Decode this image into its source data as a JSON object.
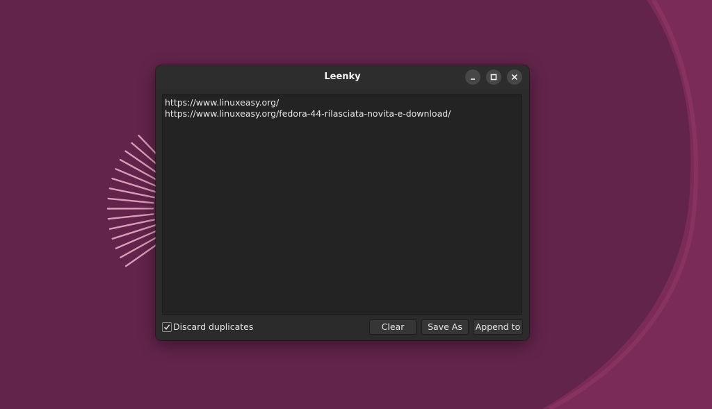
{
  "window": {
    "title": "Leenky",
    "controls": {
      "minimize_icon": "minimize-icon",
      "maximize_icon": "maximize-icon",
      "close_icon": "close-icon"
    }
  },
  "links": {
    "lines": [
      "https://www.linuxeasy.org/",
      "https://www.linuxeasy.org/fedora-44-rilasciata-novita-e-download/"
    ]
  },
  "footer": {
    "discard_duplicates_label": "Discard duplicates",
    "discard_duplicates_checked": true,
    "clear_label": "Clear",
    "save_as_label": "Save As",
    "append_to_label": "Append to"
  },
  "colors": {
    "desktop_background": "#62234a",
    "window_background": "#2b2b2b",
    "text_area_background": "#232323",
    "text": "#e6e6e6"
  }
}
